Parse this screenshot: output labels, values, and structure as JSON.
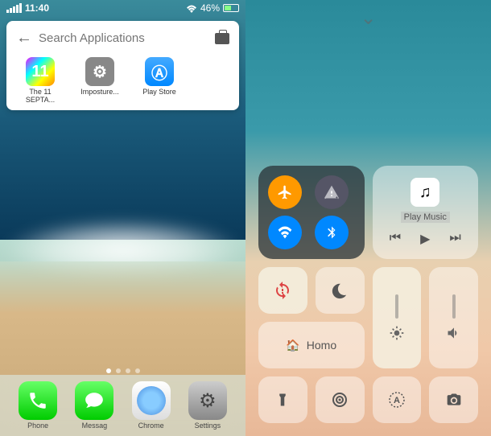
{
  "status": {
    "time": "11:40",
    "battery_pct": "46%"
  },
  "search": {
    "placeholder": "Search Applications",
    "apps": [
      {
        "label": "The 11 SEPTA...",
        "icon": "11"
      },
      {
        "label": "Imposture...",
        "icon": "gear"
      },
      {
        "label": "Play Store",
        "icon": "store"
      }
    ]
  },
  "dock": [
    {
      "label": "Phone",
      "icon": "phone"
    },
    {
      "label": "Messag",
      "icon": "msg"
    },
    {
      "label": "Chrome",
      "icon": "safari"
    },
    {
      "label": "Settings",
      "icon": "settings"
    }
  ],
  "control_center": {
    "music_label": "Play Music",
    "home_label": "Homo"
  },
  "icons": {
    "airplane": "✈",
    "data": "◣",
    "wifi_glyph": "wifi",
    "bluetooth": "bt",
    "lock_rotation": "lock",
    "dnd": "☾",
    "home": "⌂",
    "brightness": "☀",
    "volume": "vol",
    "flashlight": "flash",
    "hotspot": "◎",
    "auto_brightness": "A",
    "camera": "◯"
  }
}
